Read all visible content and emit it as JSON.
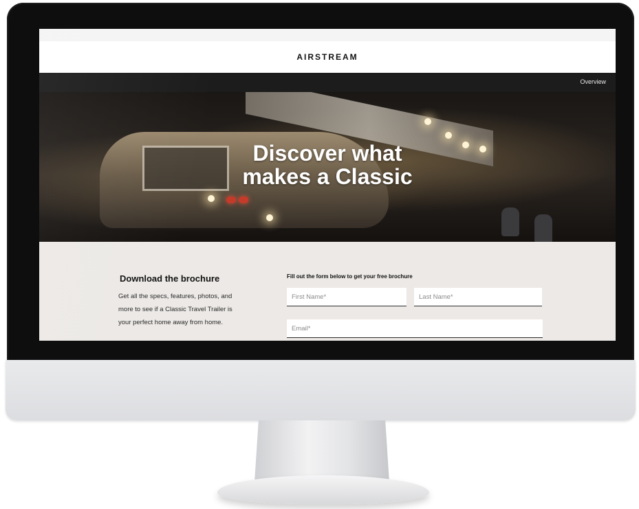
{
  "brand": {
    "logo": "AIRSTREAM"
  },
  "subnav": {
    "overview": "Overview"
  },
  "hero": {
    "title": "Discover what\nmakes a Classic"
  },
  "brochure": {
    "title": "Download the brochure",
    "description": "Get all the specs, features, photos, and more to see if a Classic Travel Trailer is your perfect home away from home."
  },
  "form": {
    "title": "Fill out the form below to get your free brochure",
    "first_name_placeholder": "First Name*",
    "last_name_placeholder": "Last Name*",
    "email_placeholder": "Email*"
  },
  "colors": {
    "nav_bg": "#1c1c1c",
    "page_bg": "#ece9e6",
    "text": "#111111"
  }
}
